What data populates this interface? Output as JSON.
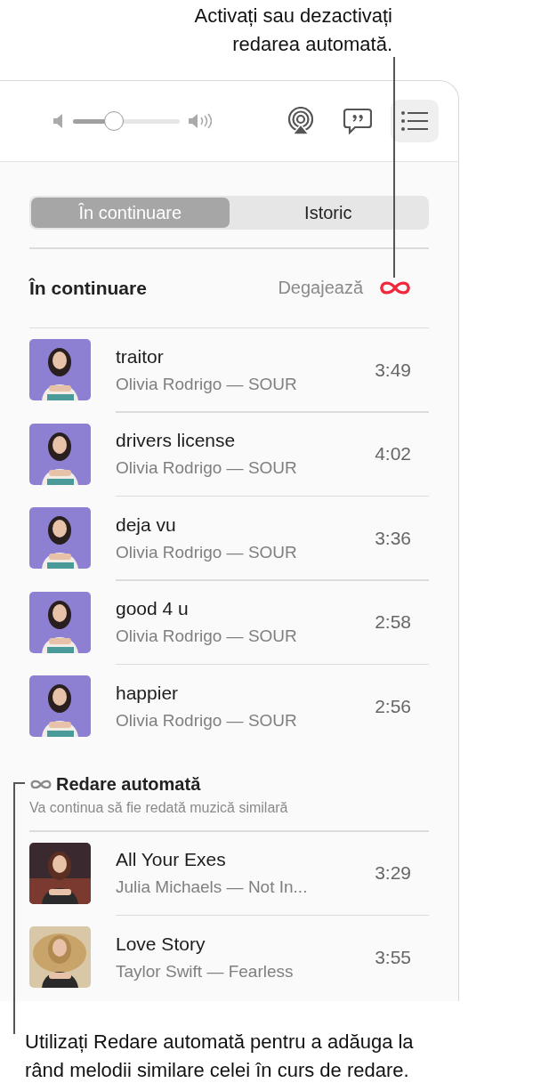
{
  "callout_top": "Activați sau dezactivați\nredarea automată.",
  "toolbar": {
    "volume": {
      "level": 0.38
    },
    "queue_button": {
      "selected": true
    }
  },
  "tabs": [
    {
      "label": "În continuare",
      "selected": true
    },
    {
      "label": "Istoric",
      "selected": false
    }
  ],
  "queue_header": {
    "title": "În continuare",
    "clear": "Degajează",
    "autoplay_on": true
  },
  "queue": [
    {
      "title": "traitor",
      "subtitle": "Olivia Rodrigo — SOUR",
      "duration": "3:49"
    },
    {
      "title": "drivers license",
      "subtitle": "Olivia Rodrigo — SOUR",
      "duration": "4:02"
    },
    {
      "title": "deja vu",
      "subtitle": "Olivia Rodrigo — SOUR",
      "duration": "3:36"
    },
    {
      "title": "good 4 u",
      "subtitle": "Olivia Rodrigo — SOUR",
      "duration": "2:58"
    },
    {
      "title": "happier",
      "subtitle": "Olivia Rodrigo — SOUR",
      "duration": "2:56"
    }
  ],
  "autoplay": {
    "title": "Redare automată",
    "subtitle": "Va continua să fie redată muzică similară"
  },
  "autoplay_tracks": [
    {
      "title": "All Your Exes",
      "subtitle": "Julia Michaels — Not In...",
      "duration": "3:29"
    },
    {
      "title": "Love Story",
      "subtitle": "Taylor Swift — Fearless",
      "duration": "3:55"
    }
  ],
  "callout_bottom": "Utilizați Redare automată pentru a adăuga la\nrând melodii similare celei în curs de redare."
}
